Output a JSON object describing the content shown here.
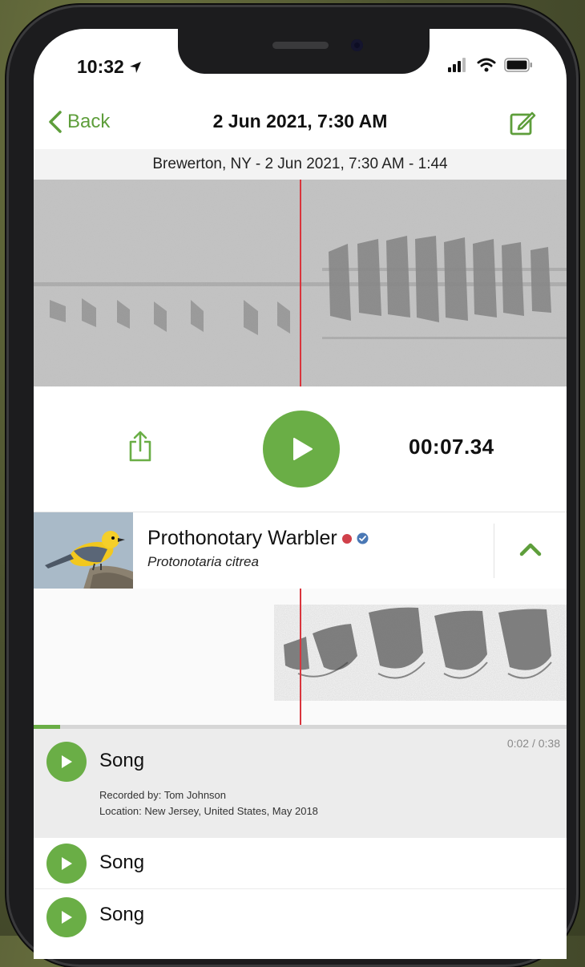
{
  "status_bar": {
    "time": "10:32"
  },
  "navbar": {
    "back_label": "Back",
    "title": "2 Jun 2021, 7:30 AM"
  },
  "recording_info": "Brewerton, NY - 2 Jun 2021, 7:30 AM - 1:44",
  "player": {
    "elapsed": "00:07.34"
  },
  "species": {
    "common_name": "Prothonotary Warbler",
    "scientific_name": "Protonotaria citrea"
  },
  "sound_progress": 0.05,
  "sounds": [
    {
      "label": "Song",
      "time": "0:02 / 0:38",
      "recorded_by": "Recorded by: Tom Johnson",
      "location": "Location: New Jersey, United States, May 2018"
    },
    {
      "label": "Song"
    },
    {
      "label": "Song"
    }
  ],
  "colors": {
    "accent": "#6aae46",
    "playhead": "#d9343c",
    "rare_dot": "#d0404a",
    "verified": "#4a78b5"
  }
}
